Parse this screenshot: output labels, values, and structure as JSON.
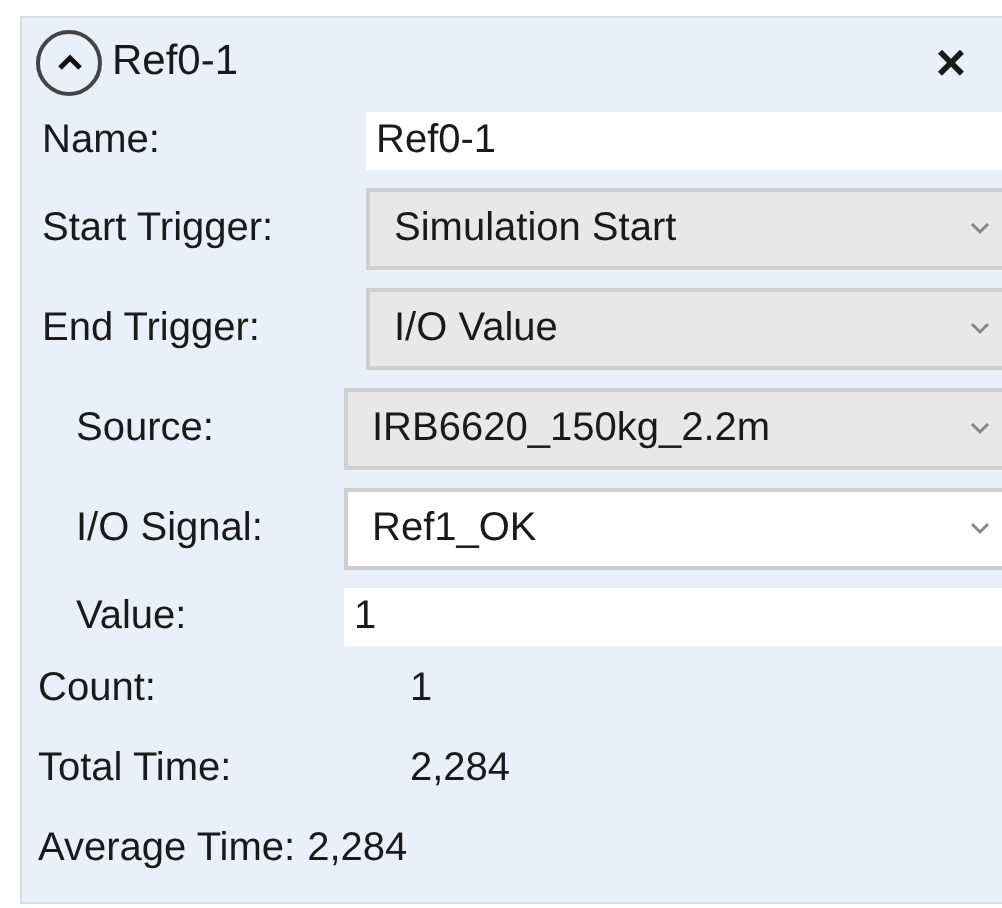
{
  "panel": {
    "title": "Ref0-1",
    "expanded": true,
    "close_label": "×"
  },
  "fields": [
    {
      "label": "Name:",
      "kind": "text_field",
      "value": "Ref0-1"
    },
    {
      "label": "Start Trigger:",
      "kind": "dropdown",
      "value": "Simulation Start"
    },
    {
      "label": "End Trigger:",
      "kind": "dropdown",
      "value": "I/O Value",
      "children": [
        {
          "label": "Source:",
          "kind": "dropdown",
          "value": "IRB6620_150kg_2.2m"
        },
        {
          "label": "I/O Signal:",
          "kind": "combo_box",
          "value": "Ref1_OK"
        },
        {
          "label": "Value:",
          "kind": "text_field",
          "value": "1"
        }
      ]
    }
  ],
  "stats": [
    {
      "label": "Count:",
      "value": "1"
    },
    {
      "label": "Total Time:",
      "value": "2,284"
    },
    {
      "label": "Average Time:",
      "value": "2,284"
    }
  ]
}
